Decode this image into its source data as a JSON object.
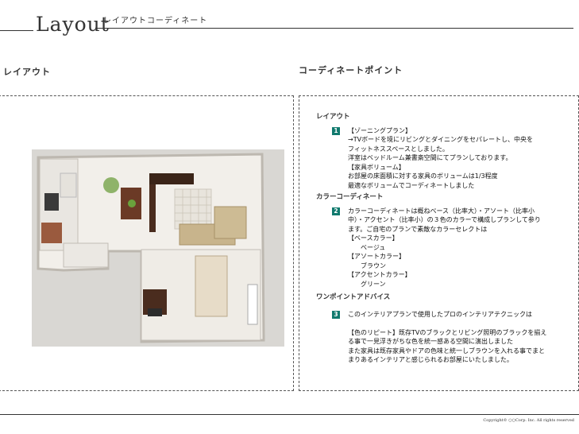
{
  "header": {
    "title": "Layout",
    "subtitle": "レイアウトコーディネート"
  },
  "sections": {
    "left_title": "レイアウト",
    "right_title": "コーディネートポイント"
  },
  "points": [
    {
      "category": "レイアウト",
      "number": "1",
      "lines": [
        "【ゾーニングプラン】",
        "→TVボードを境にリビングとダイニングをセパレートし、中央を",
        "フィットネススペースとしました。",
        "洋室はベッドルーム兼書斎空間にてプランしております。",
        "【家具ボリューム】",
        "お部屋の床面積に対する家具のボリュームは1/3程度",
        "最適なボリュームでコーディネートしました"
      ]
    },
    {
      "category": "カラーコーディネート",
      "number": "2",
      "lines": [
        "カラーコーディネートは概ねベース（比率大）・アソート（比率小",
        "中）・アクセント（比率小）の３色のカラーで構成しプランして参り",
        "ます。ご自宅のプランで素敵なカラーセレクトは",
        "【ベースカラー】",
        "　　ベージュ",
        "【アソートカラー】",
        "　　ブラウン",
        "【アクセントカラー】",
        "　　グリーン"
      ]
    },
    {
      "category": "ワンポイントアドバイス",
      "number": "3",
      "lines": [
        "このインテリアプランで使用したプロのインテリアテクニックは",
        "",
        "【色のリピート】既存TVのブラックとリビング照明のブラックを揃え",
        "る事で一見浮きがちな色を統一感ある空間に演出しました",
        "また家具は既存家具やドアの色味と統一しブラウンを入れる事でまと",
        "まりあるインテリアと感じられるお部屋にいたしました。"
      ]
    }
  ],
  "footer": {
    "copyright": "Copyright© ○○Corp. Inc. All rights reserved"
  },
  "colors": {
    "number_badge": "#117a6e"
  }
}
